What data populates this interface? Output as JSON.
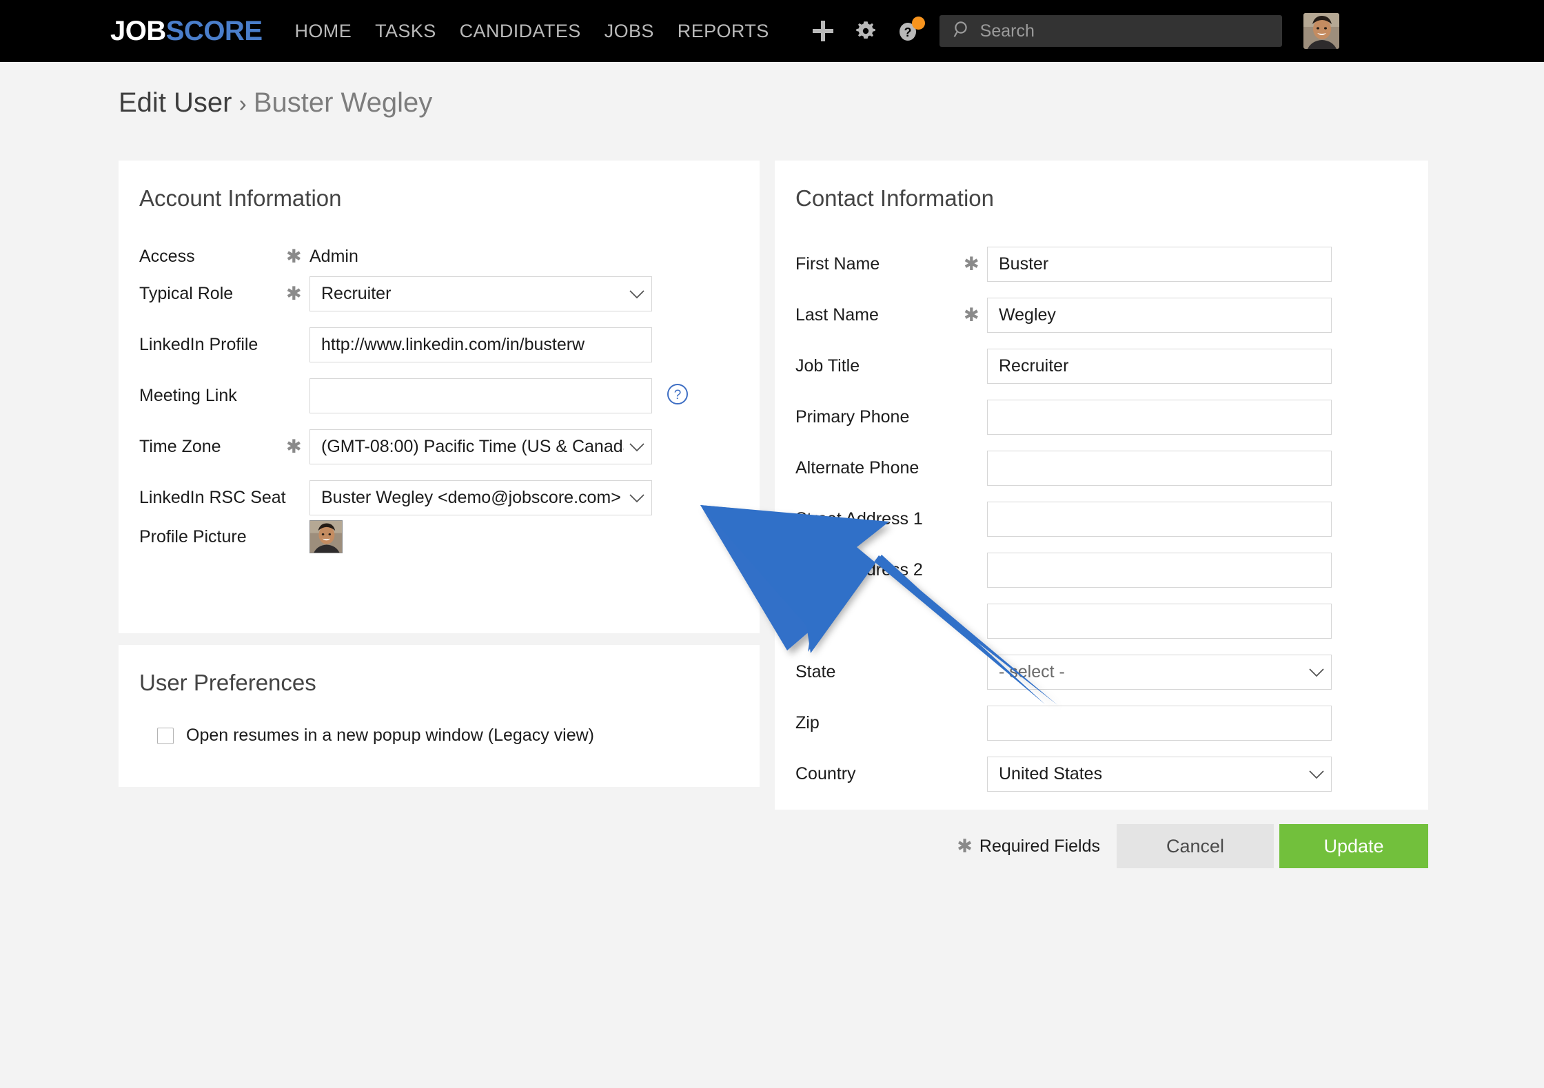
{
  "header": {
    "logo_job": "JOB",
    "logo_score": "SCORE",
    "nav": [
      {
        "label": "HOME",
        "name": "nav-home"
      },
      {
        "label": "TASKS",
        "name": "nav-tasks"
      },
      {
        "label": "CANDIDATES",
        "name": "nav-candidates"
      },
      {
        "label": "JOBS",
        "name": "nav-jobs"
      },
      {
        "label": "REPORTS",
        "name": "nav-reports"
      }
    ],
    "icons": [
      "plus-icon",
      "gear-icon",
      "help-icon"
    ],
    "search": {
      "placeholder": "Search",
      "value": ""
    }
  },
  "breadcrumb": {
    "parent": "Edit User",
    "separator": "›",
    "current": "Buster Wegley"
  },
  "account": {
    "title": "Account Information",
    "required_mark": "✱",
    "access": {
      "label": "Access",
      "value": "Admin"
    },
    "typical_role": {
      "label": "Typical Role",
      "value": "Recruiter"
    },
    "linkedin_profile": {
      "label": "LinkedIn Profile",
      "value": "http://www.linkedin.com/in/busterw"
    },
    "meeting_link": {
      "label": "Meeting Link",
      "value": ""
    },
    "time_zone": {
      "label": "Time Zone",
      "value": "(GMT-08:00) Pacific Time (US & Canada"
    },
    "linkedin_rsc_seat": {
      "label": "LinkedIn RSC Seat",
      "value": "Buster Wegley <demo@jobscore.com>"
    },
    "profile_picture": {
      "label": "Profile Picture"
    }
  },
  "preferences": {
    "title": "User Preferences",
    "checkbox_label": "Open resumes in a new popup window (Legacy view)",
    "checked": false
  },
  "contact": {
    "title": "Contact Information",
    "required_mark": "✱",
    "first_name": {
      "label": "First Name",
      "value": "Buster"
    },
    "last_name": {
      "label": "Last Name",
      "value": "Wegley"
    },
    "job_title": {
      "label": "Job Title",
      "value": "Recruiter"
    },
    "primary_phone": {
      "label": "Primary Phone",
      "value": ""
    },
    "alternate_phone": {
      "label": "Alternate Phone",
      "value": ""
    },
    "street_address_1": {
      "label": "Street Address 1",
      "value": ""
    },
    "street_address_2": {
      "label": "Street Address 2",
      "value": ""
    },
    "city": {
      "label": "",
      "value": ""
    },
    "state": {
      "label": "State",
      "value": "- select -"
    },
    "zip": {
      "label": "Zip",
      "value": ""
    },
    "country": {
      "label": "Country",
      "value": "United States"
    }
  },
  "footer": {
    "required_mark": "✱",
    "required_note": "Required Fields",
    "cancel": "Cancel",
    "update": "Update"
  },
  "colors": {
    "brand_blue": "#4a7ecb",
    "update_green": "#72c03c",
    "header_black": "#000000",
    "page_bg": "#f3f3f3",
    "badge_orange": "#f7941e",
    "pointer_blue": "#3070c8"
  }
}
